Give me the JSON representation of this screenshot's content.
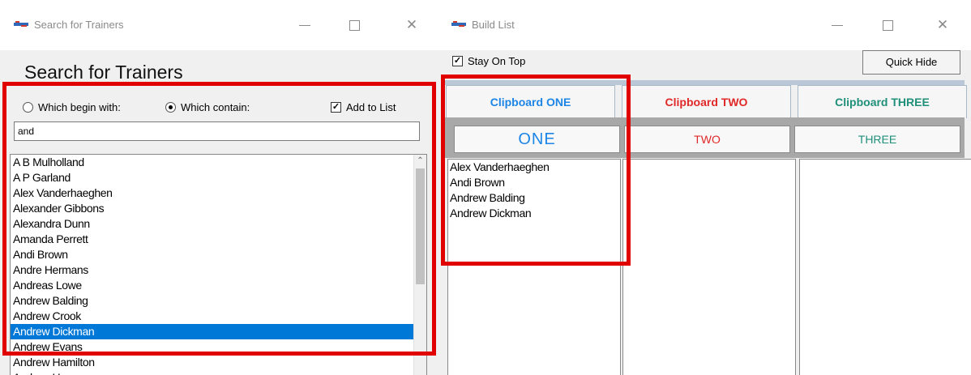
{
  "left_window": {
    "title": "Search for Trainers",
    "heading": "Search for Trainers",
    "options": {
      "begin_label": "Which begin with:",
      "contain_label": "Which contain:",
      "add_label": "Add to List",
      "begin_selected": false,
      "contain_selected": true,
      "add_checked": true
    },
    "search_value": "and",
    "trainers": [
      "A B Mulholland",
      "A P Garland",
      "Alex Vanderhaeghen",
      "Alexander Gibbons",
      "Alexandra Dunn",
      "Amanda Perrett",
      "Andi Brown",
      "Andre Hermans",
      "Andreas Lowe",
      "Andrew Balding",
      "Andrew Crook",
      "Andrew Dickman",
      "Andrew Evans",
      "Andrew Hamilton",
      "Andrew Hay"
    ],
    "selected_trainer": "Andrew Dickman"
  },
  "right_window": {
    "title": "Build List",
    "stay_on_top_label": "Stay On Top",
    "stay_on_top_checked": true,
    "quick_hide_label": "Quick Hide",
    "clipboards": [
      {
        "label": "Clipboard ONE",
        "list_label": "ONE",
        "color": "#1c85e6",
        "items": [
          "Alex Vanderhaeghen",
          "Andi Brown",
          "Andrew Balding",
          "Andrew Dickman"
        ]
      },
      {
        "label": "Clipboard TWO",
        "list_label": "TWO",
        "color": "#e02828",
        "items": []
      },
      {
        "label": "Clipboard THREE",
        "list_label": "THREE",
        "color": "#1f8f7a",
        "items": []
      }
    ]
  },
  "colors": {
    "highlight": "#e00000",
    "selection": "#0078d7"
  }
}
